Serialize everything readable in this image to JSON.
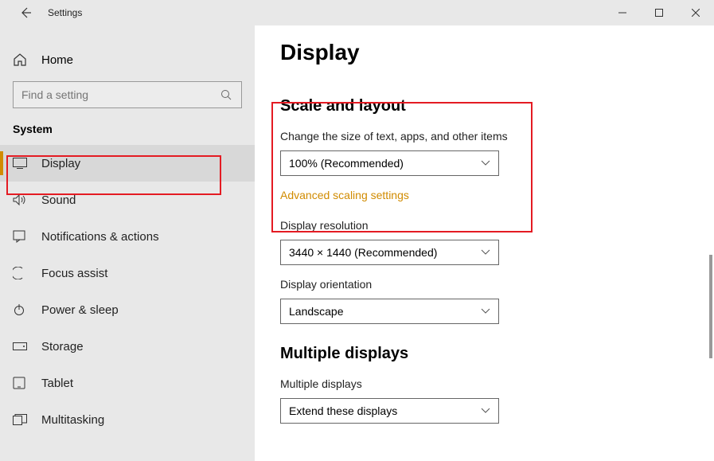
{
  "window": {
    "title": "Settings"
  },
  "sidebar": {
    "home": "Home",
    "search_placeholder": "Find a setting",
    "group": "System",
    "items": [
      {
        "label": "Display"
      },
      {
        "label": "Sound"
      },
      {
        "label": "Notifications & actions"
      },
      {
        "label": "Focus assist"
      },
      {
        "label": "Power & sleep"
      },
      {
        "label": "Storage"
      },
      {
        "label": "Tablet"
      },
      {
        "label": "Multitasking"
      }
    ]
  },
  "main": {
    "title": "Display",
    "sections": {
      "scale": {
        "heading": "Scale and layout",
        "size_label": "Change the size of text, apps, and other items",
        "size_value": "100% (Recommended)",
        "advanced_link": "Advanced scaling settings",
        "resolution_label": "Display resolution",
        "resolution_value": "3440 × 1440 (Recommended)",
        "orientation_label": "Display orientation",
        "orientation_value": "Landscape"
      },
      "multi": {
        "heading": "Multiple displays",
        "multi_label": "Multiple displays",
        "multi_value": "Extend these displays"
      }
    }
  }
}
